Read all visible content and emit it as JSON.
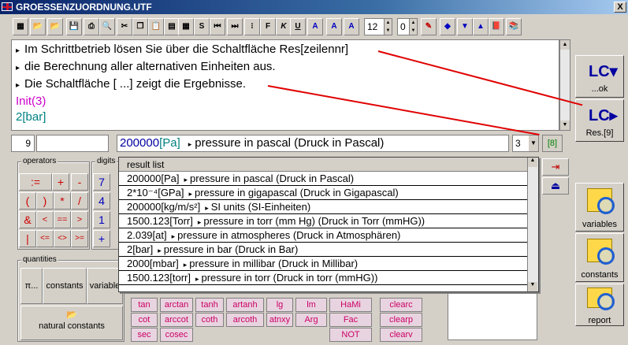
{
  "window": {
    "title": "GROESSENZUORDNUNG.UTF",
    "close_label": "X"
  },
  "toolbar": {
    "font_labels": [
      "F",
      "K",
      "U"
    ],
    "fontsize_value": "12",
    "decimals_value": "0"
  },
  "editor": {
    "lines": [
      "Im Schrittbetrieb lösen Sie über die Schaltfläche Res[zeilennr]",
      "die Berechnung aller alternativen Einheiten aus.",
      "Die Schaltfläche [ ...] zeigt die Ergebnisse."
    ],
    "code1": "Init(3)",
    "code2_num": "2",
    "code2_unit": "[bar]"
  },
  "right_buttons": {
    "ok_label": "...ok",
    "res_label": "Res.[9]",
    "variables_label": "variables",
    "constants_label": "constants",
    "report_label": "report"
  },
  "status": {
    "line_no": "9",
    "expr_value": "200000",
    "expr_unit": "[Pa]",
    "expr_text": "pressure in pascal (Druck in Pascal)",
    "count": "3",
    "btn_8": "[8]"
  },
  "groups": {
    "operators": "operators",
    "digits": "digits",
    "quantities": "quantities"
  },
  "operator_keys": [
    ":=",
    "+",
    "-",
    "(",
    ")",
    "*",
    "/",
    "&",
    "<",
    "==",
    ">",
    "|",
    "<=",
    "<>",
    ">="
  ],
  "digit_keys": [
    "7",
    "4",
    "1",
    "+"
  ],
  "quantities": {
    "pi": "π...",
    "constants": "constants",
    "variables": "variable",
    "natural_constants": "natural constants"
  },
  "functions": [
    [
      "tan",
      "arctan",
      "tanh",
      "artanh",
      "lg",
      "lm",
      "HaMi"
    ],
    [
      "cot",
      "arccot",
      "coth",
      "arcoth",
      "atnxy",
      "Arg",
      "Fac"
    ],
    [
      "sec",
      "cosec",
      "",
      "",
      "",
      "",
      "NOT"
    ]
  ],
  "clear_keys": [
    "clearc",
    "clearp",
    "clearv"
  ],
  "result_list": {
    "header": "result list",
    "rows": [
      {
        "value": "200000",
        "unit": "[Pa]",
        "text": "pressure in pascal (Druck in Pascal)"
      },
      {
        "value": "2*10⁻⁴",
        "unit": "[GPa]",
        "text": "pressure in gigapascal (Druck in Gigapascal)"
      },
      {
        "value": "200000",
        "unit": "[kg/m/s²]",
        "text": "SI units (SI-Einheiten)"
      },
      {
        "value": "1500.123",
        "unit": "[Torr]",
        "text": "pressure in torr (mm Hg) (Druck in Torr (mmHG))"
      },
      {
        "value": "2.039",
        "unit": "[at]",
        "text": "pressure in atmospheres (Druck in Atmosphären)"
      },
      {
        "value": "2",
        "unit": "[bar]",
        "text": "pressure in bar (Druck in Bar)"
      },
      {
        "value": "2000",
        "unit": "[mbar]",
        "text": "pressure in millibar (Druck in Millibar)"
      },
      {
        "value": "1500.123",
        "unit": "[torr]",
        "text": "pressure in torr (Druck in torr (mmHG))"
      }
    ]
  },
  "colors": {
    "annotation_arrow": "#e00000",
    "code_pink": "#cc00cc",
    "unit_teal": "#008080"
  }
}
